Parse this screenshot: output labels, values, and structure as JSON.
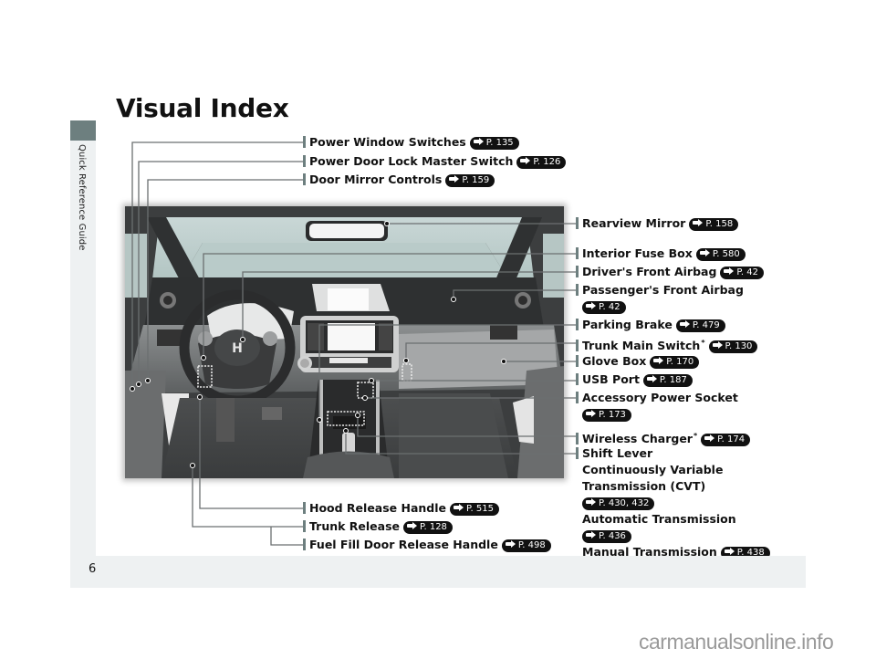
{
  "page": {
    "title": "Visual Index",
    "section_tab": "Quick Reference Guide",
    "page_number": "6",
    "watermark": "carmanualsonline.info"
  },
  "colors": {
    "tab_accent": "#6d7f7f",
    "band": "#eef1f2",
    "badge": "#111111"
  },
  "callouts_left_top": [
    {
      "label": "Power Window Switches",
      "ref": "P. 135"
    },
    {
      "label": "Power Door Lock Master Switch",
      "ref": "P. 126"
    },
    {
      "label": "Door Mirror Controls",
      "ref": "P. 159"
    }
  ],
  "callouts_right": [
    {
      "label": "Rearview Mirror",
      "ref": "P. 158"
    },
    {
      "label": "Interior Fuse Box",
      "ref": "P. 580"
    },
    {
      "label": "Driver's Front Airbag",
      "ref": "P. 42"
    },
    {
      "label": "Passenger's Front Airbag",
      "ref": "P. 42"
    },
    {
      "label": "Parking Brake",
      "ref": "P. 479"
    },
    {
      "label": "Trunk Main Switch",
      "mark": "*",
      "ref": "P. 130"
    },
    {
      "label": "Glove Box",
      "ref": "P. 170"
    },
    {
      "label": "USB Port",
      "ref": "P. 187"
    },
    {
      "label": "Accessory Power Socket",
      "ref": "P. 173"
    },
    {
      "label": "Wireless Charger",
      "mark": "*",
      "ref": "P. 174"
    },
    {
      "label": "Shift Lever",
      "sub": [
        {
          "label_lines": [
            "Continuously Variable",
            "Transmission (CVT)"
          ],
          "ref": "P. 430, 432"
        },
        {
          "label_lines": [
            "Automatic Transmission"
          ],
          "ref": "P. 436"
        },
        {
          "label_lines": [
            "Manual Transmission"
          ],
          "ref": "P. 438"
        }
      ]
    }
  ],
  "callouts_bottom": [
    {
      "label": "Hood Release Handle",
      "ref": "P. 515"
    },
    {
      "label": "Trunk Release",
      "ref": "P. 128"
    },
    {
      "label": "Fuel Fill Door Release Handle",
      "ref": "P. 498"
    }
  ],
  "illustration": {
    "subject": "car-interior-dashboard",
    "brand_emblem": "H"
  }
}
